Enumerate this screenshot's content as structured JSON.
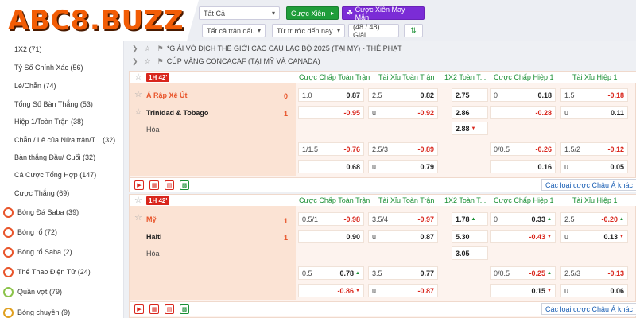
{
  "logo": {
    "text": "ABC8.BUZZ"
  },
  "sidebar": {
    "sub_items": [
      {
        "label": "1X2 (71)"
      },
      {
        "label": "Tỷ Số Chính Xác (56)"
      },
      {
        "label": "Lẻ/Chẵn (74)"
      },
      {
        "label": "Tổng Số Bàn Thắng (53)"
      },
      {
        "label": "Hiệp 1/Toàn Trận (38)"
      },
      {
        "label": "Chẵn / Lẻ của Nửa trận/T... (32)"
      },
      {
        "label": "Bàn thắng Đầu/ Cuối (32)"
      },
      {
        "label": "Cá Cược Tổng Hợp (147)"
      },
      {
        "label": "Cược Thắng (69)"
      }
    ],
    "sports": [
      {
        "label": "Bóng Đá Saba",
        "count": "(39)"
      },
      {
        "label": "Bóng rổ",
        "count": "(72)"
      },
      {
        "label": "Bóng rổ Saba",
        "count": "(2)"
      },
      {
        "label": "Thể Thao Điện Tử",
        "count": "(24)"
      },
      {
        "label": "Quần vợt",
        "count": "(79)"
      },
      {
        "label": "Bóng chuyền",
        "count": "(9)"
      }
    ]
  },
  "toolbar": {
    "filter_all": "Tất Cả",
    "parlay": "Cược Xiên",
    "lucky_parlay": "Cược Xiên May Mắn",
    "all_matches": "Tất cả trận đấu",
    "sort": "Từ trước đến nay",
    "count": "(48 / 48) Giải"
  },
  "leagues": [
    {
      "name": "*GIẢI VÔ ĐỊCH THẾ GIỚI CÁC CÂU LẠC BỘ 2025 (TẠI MỸ) - THẺ PHẠT"
    },
    {
      "name": "CÚP VÀNG CONCACAF (TẠI MỸ VÀ CANADA)"
    }
  ],
  "columns": [
    "Cược Chấp Toàn Trận",
    "Tài Xỉu Toàn Trận",
    "1X2 Toàn T...",
    "Cược Chấp Hiệp 1",
    "Tài Xỉu Hiệp 1"
  ],
  "more_link": "Các loại cược Châu Á khác",
  "matches": [
    {
      "live": "1H 42'",
      "home": "Ả Rập Xê Út",
      "away": "Trinidad & Tobago",
      "draw": "Hòa",
      "home_score": "0",
      "away_score": "1",
      "r1": {
        "hcp": "1.0",
        "hcp_h": "0.87",
        "ou": "2.5",
        "ou_o": "0.82",
        "x12": "2.75",
        "h1": "0",
        "h1_h": "0.18",
        "h1ou": "1.5",
        "h1ou_o": "-0.18"
      },
      "r2": {
        "hcp_a": "-0.95",
        "ou_u": "u",
        "ou_u_v": "-0.92",
        "x12": "2.86",
        "h1_a": "-0.28",
        "h1ou_u": "u",
        "h1ou_u_v": "0.11"
      },
      "r3": {
        "x12": "2.88"
      },
      "r4": {
        "hcp": "1/1.5",
        "hcp_h": "-0.76",
        "ou": "2.5/3",
        "ou_o": "-0.89",
        "h1": "0/0.5",
        "h1_h": "-0.26",
        "h1ou": "1.5/2",
        "h1ou_o": "-0.12"
      },
      "r5": {
        "hcp_a": "0.68",
        "ou_u": "u",
        "ou_u_v": "0.79",
        "h1_a": "0.16",
        "h1ou_u": "u",
        "h1ou_u_v": "0.05"
      }
    },
    {
      "live": "1H 42'",
      "home": "Mỹ",
      "away": "Haiti",
      "draw": "Hòa",
      "home_score": "1",
      "away_score": "1",
      "r1": {
        "hcp": "0.5/1",
        "hcp_h": "-0.98",
        "ou": "3.5/4",
        "ou_o": "-0.97",
        "x12": "1.78",
        "h1": "0",
        "h1_h": "0.33",
        "h1ou": "2.5",
        "h1ou_o": "-0.20"
      },
      "r2": {
        "hcp_a": "0.90",
        "ou_u": "u",
        "ou_u_v": "0.87",
        "x12": "5.30",
        "h1_a": "-0.43",
        "h1ou_u": "u",
        "h1ou_u_v": "0.13"
      },
      "r3": {
        "x12": "3.05"
      },
      "r4": {
        "hcp": "0.5",
        "hcp_h": "0.78",
        "ou": "3.5",
        "ou_o": "0.77",
        "h1": "0/0.5",
        "h1_h": "-0.25",
        "h1ou": "2.5/3",
        "h1ou_o": "-0.13"
      },
      "r5": {
        "hcp_a": "-0.86",
        "ou_u": "u",
        "ou_u_v": "-0.87",
        "h1_a": "0.15",
        "h1ou_u": "u",
        "h1ou_u_v": "0.06"
      }
    }
  ],
  "colors": {
    "accent": "#e8542a",
    "green": "#1f9d3a",
    "purple": "#7b2cd6",
    "red": "#d9261c"
  }
}
